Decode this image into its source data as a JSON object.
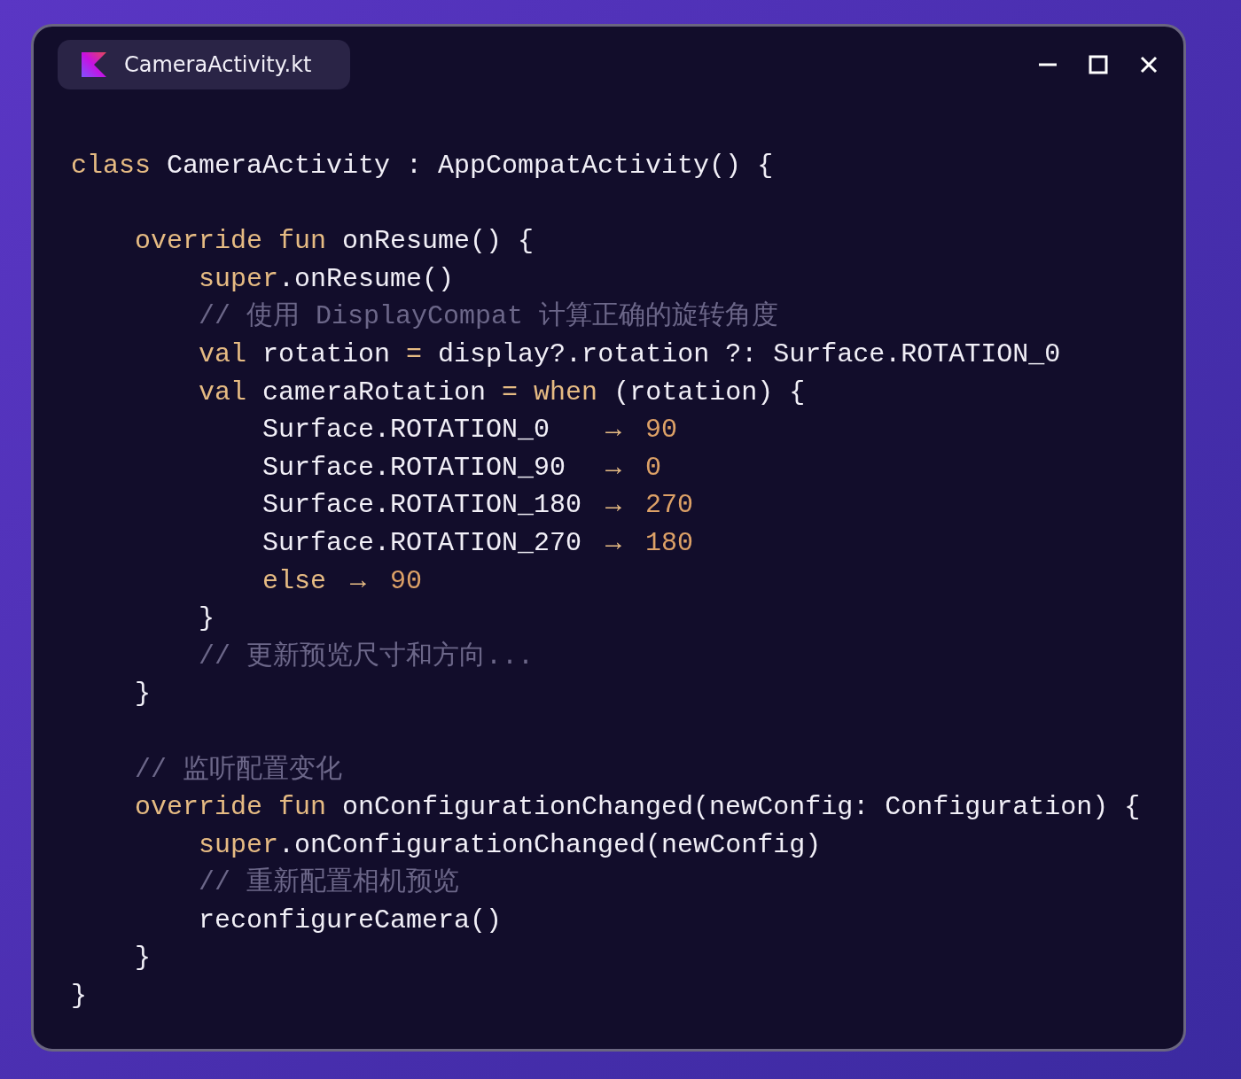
{
  "window": {
    "title": "CameraActivity.kt"
  },
  "code": {
    "lines": [
      {
        "kind": "code",
        "tokens": [
          {
            "kind": "kw",
            "text": "class"
          },
          {
            "kind": "plain",
            "text": " CameraActivity : AppCompatActivity() {"
          }
        ]
      },
      {
        "kind": "blank"
      },
      {
        "kind": "code",
        "tokens": [
          {
            "kind": "kw",
            "text": "    override fun"
          },
          {
            "kind": "plain",
            "text": " onResume() {"
          }
        ]
      },
      {
        "kind": "code",
        "tokens": [
          {
            "kind": "kw",
            "text": "        super"
          },
          {
            "kind": "plain",
            "text": ".onResume()"
          }
        ]
      },
      {
        "kind": "code",
        "tokens": [
          {
            "kind": "comment",
            "text": "        // 使用 DisplayCompat 计算正确的旋转角度"
          }
        ]
      },
      {
        "kind": "code",
        "tokens": [
          {
            "kind": "kw",
            "text": "        val"
          },
          {
            "kind": "plain",
            "text": " rotation "
          },
          {
            "kind": "op",
            "text": "="
          },
          {
            "kind": "plain",
            "text": " display?.rotation ?: Surface.ROTATION_0"
          }
        ]
      },
      {
        "kind": "code",
        "tokens": [
          {
            "kind": "kw",
            "text": "        val"
          },
          {
            "kind": "plain",
            "text": " cameraRotation "
          },
          {
            "kind": "op",
            "text": "="
          },
          {
            "kind": "kw",
            "text": " when"
          },
          {
            "kind": "plain",
            "text": " (rotation) {"
          }
        ]
      },
      {
        "kind": "code",
        "tokens": [
          {
            "kind": "plain",
            "text": "            Surface.ROTATION_0   "
          },
          {
            "kind": "arrow",
            "text": "→"
          },
          {
            "kind": "num",
            "text": " 90"
          }
        ]
      },
      {
        "kind": "code",
        "tokens": [
          {
            "kind": "plain",
            "text": "            Surface.ROTATION_90  "
          },
          {
            "kind": "arrow",
            "text": "→"
          },
          {
            "kind": "num",
            "text": " 0"
          }
        ]
      },
      {
        "kind": "code",
        "tokens": [
          {
            "kind": "plain",
            "text": "            Surface.ROTATION_180 "
          },
          {
            "kind": "arrow",
            "text": "→"
          },
          {
            "kind": "num",
            "text": " 270"
          }
        ]
      },
      {
        "kind": "code",
        "tokens": [
          {
            "kind": "plain",
            "text": "            Surface.ROTATION_270 "
          },
          {
            "kind": "arrow",
            "text": "→"
          },
          {
            "kind": "num",
            "text": " 180"
          }
        ]
      },
      {
        "kind": "code",
        "tokens": [
          {
            "kind": "kw",
            "text": "            else "
          },
          {
            "kind": "arrow",
            "text": "→"
          },
          {
            "kind": "num",
            "text": " 90"
          }
        ]
      },
      {
        "kind": "code",
        "tokens": [
          {
            "kind": "plain",
            "text": "        }"
          }
        ]
      },
      {
        "kind": "code",
        "tokens": [
          {
            "kind": "comment",
            "text": "        // 更新预览尺寸和方向..."
          }
        ]
      },
      {
        "kind": "code",
        "tokens": [
          {
            "kind": "plain",
            "text": "    }"
          }
        ]
      },
      {
        "kind": "blank"
      },
      {
        "kind": "code",
        "tokens": [
          {
            "kind": "comment",
            "text": "    // 监听配置变化"
          }
        ]
      },
      {
        "kind": "code",
        "tokens": [
          {
            "kind": "kw",
            "text": "    override fun"
          },
          {
            "kind": "plain",
            "text": " onConfigurationChanged(newConfig: Configuration) {"
          }
        ]
      },
      {
        "kind": "code",
        "tokens": [
          {
            "kind": "kw",
            "text": "        super"
          },
          {
            "kind": "plain",
            "text": ".onConfigurationChanged(newConfig)"
          }
        ]
      },
      {
        "kind": "code",
        "tokens": [
          {
            "kind": "comment",
            "text": "        // 重新配置相机预览"
          }
        ]
      },
      {
        "kind": "code",
        "tokens": [
          {
            "kind": "plain",
            "text": "        reconfigureCamera()"
          }
        ]
      },
      {
        "kind": "code",
        "tokens": [
          {
            "kind": "plain",
            "text": "    }"
          }
        ]
      },
      {
        "kind": "code",
        "tokens": [
          {
            "kind": "plain",
            "text": "}"
          }
        ]
      }
    ]
  }
}
